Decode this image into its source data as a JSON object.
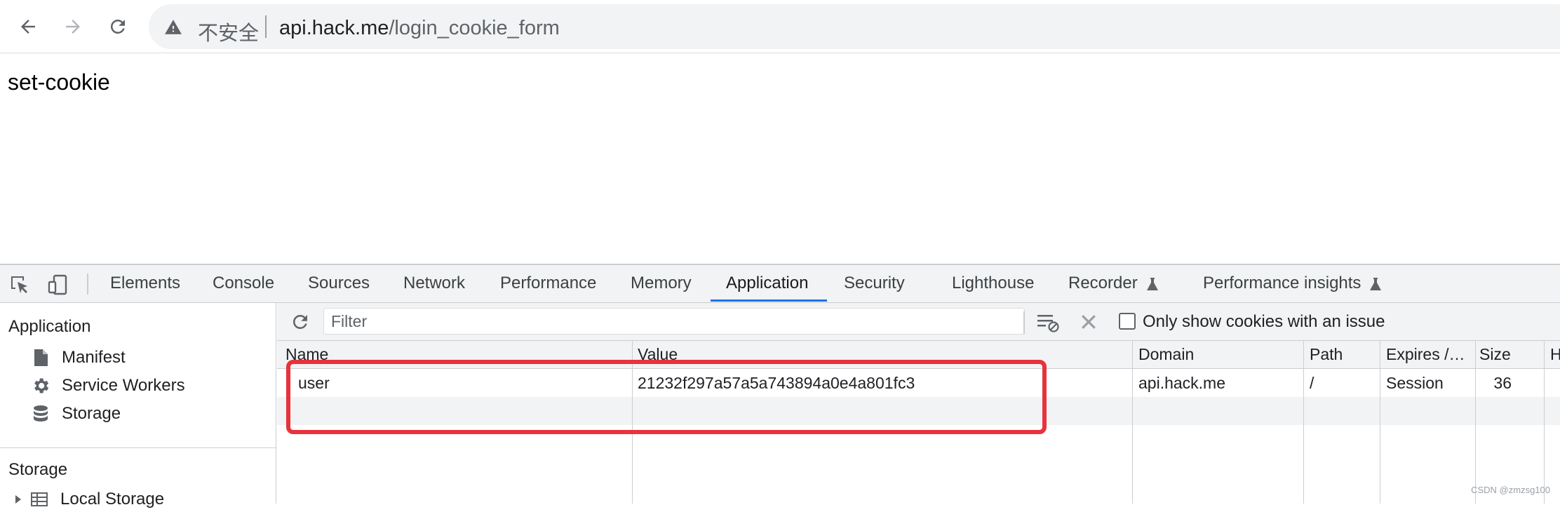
{
  "browser": {
    "back_icon": "arrow-left-icon",
    "forward_icon": "arrow-right-icon",
    "reload_icon": "reload-icon",
    "omnibox": {
      "security_label": "不安全",
      "url_host": "api.hack.me",
      "url_path": "/login_cookie_form"
    }
  },
  "page": {
    "text": "set-cookie"
  },
  "devtools": {
    "tabs": [
      {
        "label": "Elements"
      },
      {
        "label": "Console"
      },
      {
        "label": "Sources"
      },
      {
        "label": "Network"
      },
      {
        "label": "Performance"
      },
      {
        "label": "Memory"
      },
      {
        "label": "Application",
        "active": true
      },
      {
        "label": "Security"
      },
      {
        "label": "Lighthouse"
      },
      {
        "label": "Recorder"
      },
      {
        "label": "Performance insights"
      }
    ],
    "sidebar": {
      "application_heading": "Application",
      "items": [
        {
          "label": "Manifest",
          "icon": "document-icon"
        },
        {
          "label": "Service Workers",
          "icon": "gear-icon"
        },
        {
          "label": "Storage",
          "icon": "database-icon"
        }
      ],
      "storage_heading": "Storage",
      "storage_items": [
        {
          "label": "Local Storage",
          "icon": "grid-icon"
        }
      ]
    },
    "cookies": {
      "filter_placeholder": "Filter",
      "only_issues_label": "Only show cookies with an issue",
      "columns": [
        "Name",
        "Value",
        "Domain",
        "Path",
        "Expires /…",
        "Size",
        "H"
      ],
      "rows": [
        {
          "name": "user",
          "value": "21232f297a57a5a743894a0e4a801fc3",
          "domain": "api.hack.me",
          "path": "/",
          "expires": "Session",
          "size": "36"
        }
      ]
    }
  },
  "watermark": "CSDN @zmzsg100",
  "colors": {
    "accent": "#1a73e8",
    "highlight": "#e8323c"
  }
}
